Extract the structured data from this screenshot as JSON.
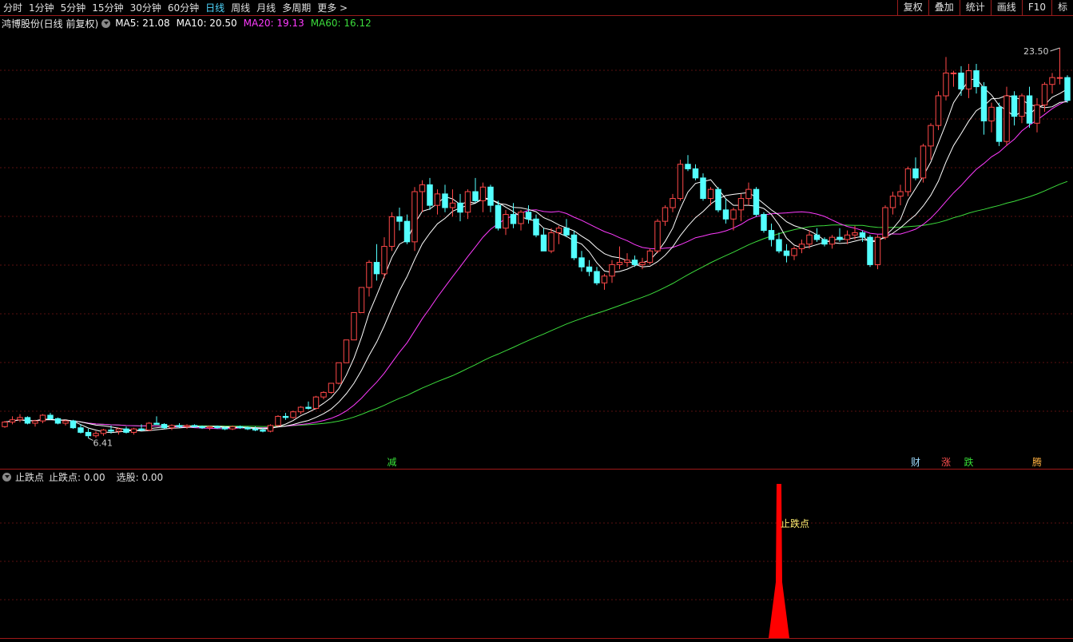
{
  "toolbar": {
    "periods": [
      "分时",
      "1分钟",
      "5分钟",
      "15分钟",
      "30分钟",
      "60分钟",
      "日线",
      "周线",
      "月线",
      "多周期",
      "更多 >"
    ],
    "active_index": 6,
    "right_buttons": [
      "复权",
      "叠加",
      "统计",
      "画线",
      "F10",
      "标"
    ]
  },
  "header": {
    "stock": "鸿博股份(日线 前复权)",
    "ma": [
      {
        "label": "MA5: 21.08",
        "color": "#ffffff"
      },
      {
        "label": "MA10: 20.50",
        "color": "#ffffff"
      },
      {
        "label": "MA20: 19.13",
        "color": "#ff3bff"
      },
      {
        "label": "MA60: 16.12",
        "color": "#3cdc3c"
      }
    ]
  },
  "price_labels": {
    "high": "23.50",
    "low": "6.41"
  },
  "markers": [
    {
      "text": "减",
      "color": "#38e038",
      "index": 51
    },
    {
      "text": "财",
      "color": "#9fdcff",
      "index": 120
    },
    {
      "text": "涨",
      "color": "#ff5050",
      "index": 124
    },
    {
      "text": "跌",
      "color": "#38e038",
      "index": 127
    },
    {
      "text": "腾",
      "color": "#ffb040",
      "index": 136
    }
  ],
  "indicator": {
    "name": "止跌点",
    "values": [
      "止跌点: 0.00",
      "选股: 0.00"
    ],
    "signal_label": "止跌点",
    "signal_index": 102
  },
  "colors": {
    "up": "#ff4848",
    "down": "#54ffff",
    "grid": "#5a1010",
    "ma20": "#ff3bff",
    "ma60": "#3cdc3c",
    "signal": "#ff0000"
  },
  "chart_data": {
    "type": "candlestick",
    "ylim": [
      6.0,
      24.2
    ],
    "ohlc": [
      [
        6.9,
        7.15,
        6.85,
        7.1
      ],
      [
        7.1,
        7.35,
        7.0,
        7.2
      ],
      [
        7.2,
        7.45,
        7.1,
        7.3
      ],
      [
        7.3,
        7.35,
        7.0,
        7.05
      ],
      [
        7.05,
        7.2,
        6.9,
        7.15
      ],
      [
        7.15,
        7.45,
        7.05,
        7.4
      ],
      [
        7.4,
        7.5,
        7.2,
        7.25
      ],
      [
        7.25,
        7.3,
        7.0,
        7.05
      ],
      [
        7.05,
        7.2,
        6.95,
        7.15
      ],
      [
        7.15,
        7.2,
        6.8,
        6.85
      ],
      [
        6.85,
        7.0,
        6.6,
        6.65
      ],
      [
        6.65,
        6.8,
        6.4,
        6.5
      ],
      [
        6.5,
        6.7,
        6.41,
        6.6
      ],
      [
        6.6,
        6.8,
        6.5,
        6.75
      ],
      [
        6.75,
        6.95,
        6.6,
        6.7
      ],
      [
        6.7,
        6.85,
        6.55,
        6.8
      ],
      [
        6.8,
        6.9,
        6.6,
        6.65
      ],
      [
        6.65,
        6.85,
        6.55,
        6.8
      ],
      [
        6.8,
        7.0,
        6.7,
        6.75
      ],
      [
        6.75,
        7.1,
        6.7,
        7.05
      ],
      [
        7.05,
        7.35,
        7.0,
        7.0
      ],
      [
        7.0,
        7.05,
        6.8,
        6.85
      ],
      [
        6.85,
        7.0,
        6.75,
        6.95
      ],
      [
        6.95,
        7.05,
        6.85,
        6.9
      ],
      [
        6.9,
        7.0,
        6.8,
        6.95
      ],
      [
        6.95,
        7.0,
        6.85,
        6.9
      ],
      [
        6.9,
        6.95,
        6.8,
        6.85
      ],
      [
        6.85,
        6.95,
        6.75,
        6.9
      ],
      [
        6.9,
        6.95,
        6.8,
        6.85
      ],
      [
        6.85,
        6.9,
        6.75,
        6.8
      ],
      [
        6.8,
        6.95,
        6.75,
        6.9
      ],
      [
        6.9,
        6.95,
        6.8,
        6.85
      ],
      [
        6.85,
        6.9,
        6.75,
        6.8
      ],
      [
        6.8,
        6.9,
        6.7,
        6.75
      ],
      [
        6.75,
        6.85,
        6.65,
        6.7
      ],
      [
        6.7,
        7.0,
        6.65,
        6.95
      ],
      [
        6.95,
        7.4,
        6.9,
        7.35
      ],
      [
        7.35,
        7.5,
        7.2,
        7.3
      ],
      [
        7.3,
        7.6,
        7.25,
        7.55
      ],
      [
        7.55,
        7.8,
        7.45,
        7.75
      ],
      [
        7.75,
        8.0,
        7.65,
        7.7
      ],
      [
        7.7,
        8.25,
        7.65,
        8.2
      ],
      [
        8.2,
        8.45,
        8.1,
        8.4
      ],
      [
        8.4,
        8.8,
        8.35,
        8.8
      ],
      [
        8.8,
        9.7,
        8.75,
        9.7
      ],
      [
        9.7,
        10.7,
        9.7,
        10.7
      ],
      [
        10.7,
        11.9,
        10.7,
        11.9
      ],
      [
        11.9,
        13.0,
        11.9,
        13.0
      ],
      [
        13.0,
        14.2,
        12.6,
        14.1
      ],
      [
        14.1,
        14.9,
        13.3,
        13.6
      ],
      [
        13.6,
        15.2,
        13.4,
        14.8
      ],
      [
        14.8,
        16.3,
        14.6,
        16.1
      ],
      [
        16.1,
        16.5,
        15.5,
        15.9
      ],
      [
        15.9,
        16.2,
        14.9,
        15.0
      ],
      [
        15.0,
        17.4,
        14.6,
        17.2
      ],
      [
        17.2,
        17.7,
        16.3,
        17.5
      ],
      [
        17.5,
        17.8,
        16.4,
        16.6
      ],
      [
        16.6,
        17.3,
        16.2,
        17.1
      ],
      [
        17.1,
        17.5,
        16.3,
        16.5
      ],
      [
        16.5,
        17.3,
        16.1,
        16.7
      ],
      [
        16.7,
        17.1,
        15.9,
        16.3
      ],
      [
        16.3,
        17.3,
        16.0,
        17.2
      ],
      [
        17.2,
        17.8,
        16.7,
        16.8
      ],
      [
        16.8,
        17.6,
        16.3,
        17.4
      ],
      [
        17.4,
        17.5,
        16.3,
        16.6
      ],
      [
        16.6,
        16.8,
        15.5,
        15.6
      ],
      [
        15.6,
        16.4,
        15.3,
        16.2
      ],
      [
        16.2,
        16.7,
        15.6,
        15.8
      ],
      [
        15.8,
        16.4,
        15.5,
        16.3
      ],
      [
        16.3,
        16.6,
        15.8,
        16.0
      ],
      [
        16.0,
        16.2,
        15.2,
        15.3
      ],
      [
        15.3,
        15.6,
        14.6,
        14.6
      ],
      [
        14.6,
        15.6,
        14.5,
        15.4
      ],
      [
        15.4,
        15.7,
        14.9,
        15.6
      ],
      [
        15.6,
        16.0,
        15.2,
        15.3
      ],
      [
        15.3,
        15.5,
        14.2,
        14.3
      ],
      [
        14.3,
        14.6,
        13.7,
        13.9
      ],
      [
        13.9,
        14.2,
        13.5,
        13.7
      ],
      [
        13.7,
        13.9,
        13.1,
        13.2
      ],
      [
        13.2,
        13.6,
        12.9,
        13.5
      ],
      [
        13.5,
        14.2,
        13.2,
        14.0
      ],
      [
        14.0,
        14.8,
        13.8,
        14.1
      ],
      [
        14.1,
        14.5,
        13.9,
        14.2
      ],
      [
        14.2,
        14.4,
        13.9,
        14.0
      ],
      [
        14.0,
        14.3,
        13.8,
        14.1
      ],
      [
        14.1,
        14.7,
        14.0,
        14.6
      ],
      [
        14.6,
        16.0,
        14.5,
        15.9
      ],
      [
        15.9,
        16.6,
        15.7,
        16.5
      ],
      [
        16.5,
        17.1,
        16.3,
        16.9
      ],
      [
        16.9,
        18.6,
        16.8,
        18.4
      ],
      [
        18.4,
        18.8,
        18.1,
        18.2
      ],
      [
        18.2,
        18.4,
        17.7,
        17.8
      ],
      [
        17.8,
        18.0,
        16.8,
        16.9
      ],
      [
        16.9,
        17.4,
        16.6,
        17.3
      ],
      [
        17.3,
        17.4,
        16.3,
        16.4
      ],
      [
        16.4,
        16.9,
        15.8,
        16.0
      ],
      [
        16.0,
        16.5,
        15.5,
        16.4
      ],
      [
        16.4,
        17.1,
        15.9,
        16.9
      ],
      [
        16.9,
        17.6,
        16.6,
        17.3
      ],
      [
        17.3,
        17.4,
        16.1,
        16.2
      ],
      [
        16.2,
        16.3,
        15.4,
        15.5
      ],
      [
        15.5,
        15.8,
        14.8,
        15.1
      ],
      [
        15.1,
        15.4,
        14.5,
        14.6
      ],
      [
        14.6,
        14.9,
        14.1,
        14.4
      ],
      [
        14.4,
        14.8,
        14.2,
        14.7
      ],
      [
        14.7,
        15.1,
        14.5,
        14.9
      ],
      [
        14.9,
        15.5,
        14.7,
        15.3
      ],
      [
        15.3,
        15.6,
        15.0,
        15.1
      ],
      [
        15.1,
        15.2,
        14.8,
        14.9
      ],
      [
        14.9,
        15.3,
        14.7,
        15.2
      ],
      [
        15.2,
        15.6,
        15.0,
        15.1
      ],
      [
        15.1,
        15.5,
        14.9,
        15.3
      ],
      [
        15.3,
        15.7,
        15.1,
        15.4
      ],
      [
        15.4,
        15.5,
        15.0,
        15.2
      ],
      [
        15.2,
        15.3,
        13.9,
        14.0
      ],
      [
        14.0,
        15.3,
        13.8,
        15.2
      ],
      [
        15.2,
        16.6,
        15.1,
        16.5
      ],
      [
        16.5,
        17.2,
        16.2,
        17.0
      ],
      [
        17.0,
        17.5,
        16.6,
        17.2
      ],
      [
        17.2,
        18.3,
        17.0,
        18.2
      ],
      [
        18.2,
        18.7,
        17.7,
        17.8
      ],
      [
        17.8,
        19.3,
        17.6,
        19.2
      ],
      [
        19.2,
        20.2,
        18.6,
        20.1
      ],
      [
        20.1,
        21.6,
        19.9,
        21.4
      ],
      [
        21.4,
        23.1,
        21.2,
        22.4
      ],
      [
        22.4,
        22.5,
        21.8,
        22.4
      ],
      [
        22.4,
        22.7,
        21.4,
        21.7
      ],
      [
        21.7,
        22.8,
        21.3,
        22.5
      ],
      [
        22.5,
        22.8,
        21.5,
        21.8
      ],
      [
        21.8,
        22.0,
        19.7,
        20.3
      ],
      [
        20.3,
        21.1,
        19.8,
        20.9
      ],
      [
        20.9,
        21.1,
        19.2,
        19.4
      ],
      [
        19.4,
        21.8,
        19.2,
        21.4
      ],
      [
        21.4,
        21.6,
        20.1,
        20.5
      ],
      [
        20.5,
        21.5,
        20.2,
        21.4
      ],
      [
        21.4,
        21.8,
        20.0,
        20.2
      ],
      [
        20.2,
        21.3,
        19.8,
        21.0
      ],
      [
        21.0,
        22.0,
        20.7,
        21.9
      ],
      [
        21.9,
        22.4,
        21.5,
        22.2
      ],
      [
        22.2,
        23.5,
        21.9,
        22.2
      ],
      [
        22.2,
        22.3,
        21.1,
        21.2
      ]
    ],
    "ma5_last": 21.08,
    "ma10_last": 20.5,
    "ma20_last": 19.13,
    "ma60_last": 16.12,
    "indicator_series": {
      "signal_index": 102,
      "signal_value": 1.0
    }
  }
}
